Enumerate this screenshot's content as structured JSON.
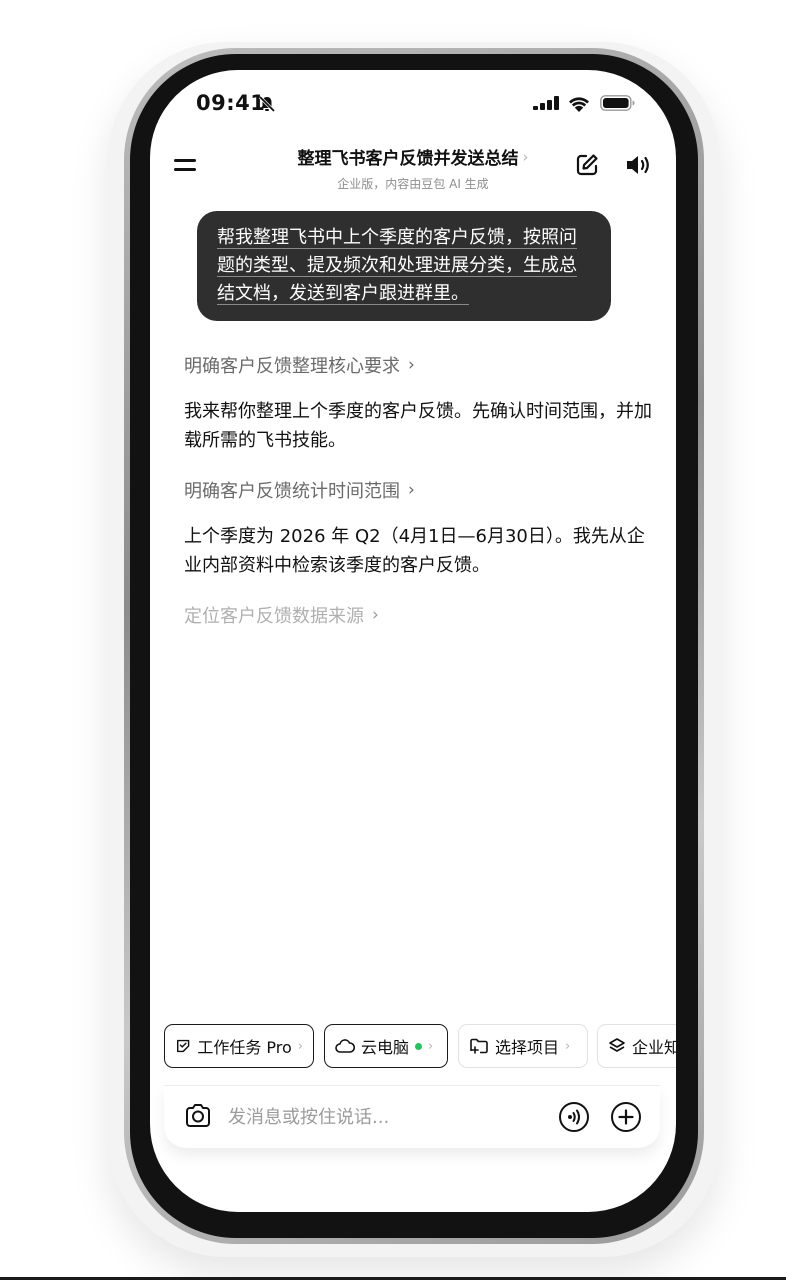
{
  "status_bar": {
    "time": "09:41"
  },
  "header": {
    "title": "整理飞书客户反馈并发送总结",
    "title_chevron": "›",
    "subtitle": "企业版，内容由豆包 AI 生成"
  },
  "user_message": "帮我整理飞书中上个季度的客户反馈，按照问题的类型、提及频次和处理进展分类，生成总结文档，发送到客户跟进群里。",
  "assistant": {
    "step1": "明确客户反馈整理核心要求",
    "para1": "我来帮你整理上个季度的客户反馈。先确认时间范围，并加载所需的飞书技能。",
    "step2": "明确客户反馈统计时间范围",
    "para2": "上个季度为 2026 年 Q2（4月1日—6月30日）。我先从企业内部资料中检索该季度的客户反馈。",
    "step3": "定位客户反馈数据来源",
    "step_arrow": "›"
  },
  "chips": {
    "work_task": "工作任务 Pro",
    "cloud_pc": "云电脑",
    "select_project": "选择项目",
    "enterprise": "企业知识",
    "arrow": "›"
  },
  "input": {
    "placeholder": "发消息或按住说话..."
  },
  "colors": {
    "status_dot": "#21c55d",
    "bubble": "#2f2f2f"
  }
}
